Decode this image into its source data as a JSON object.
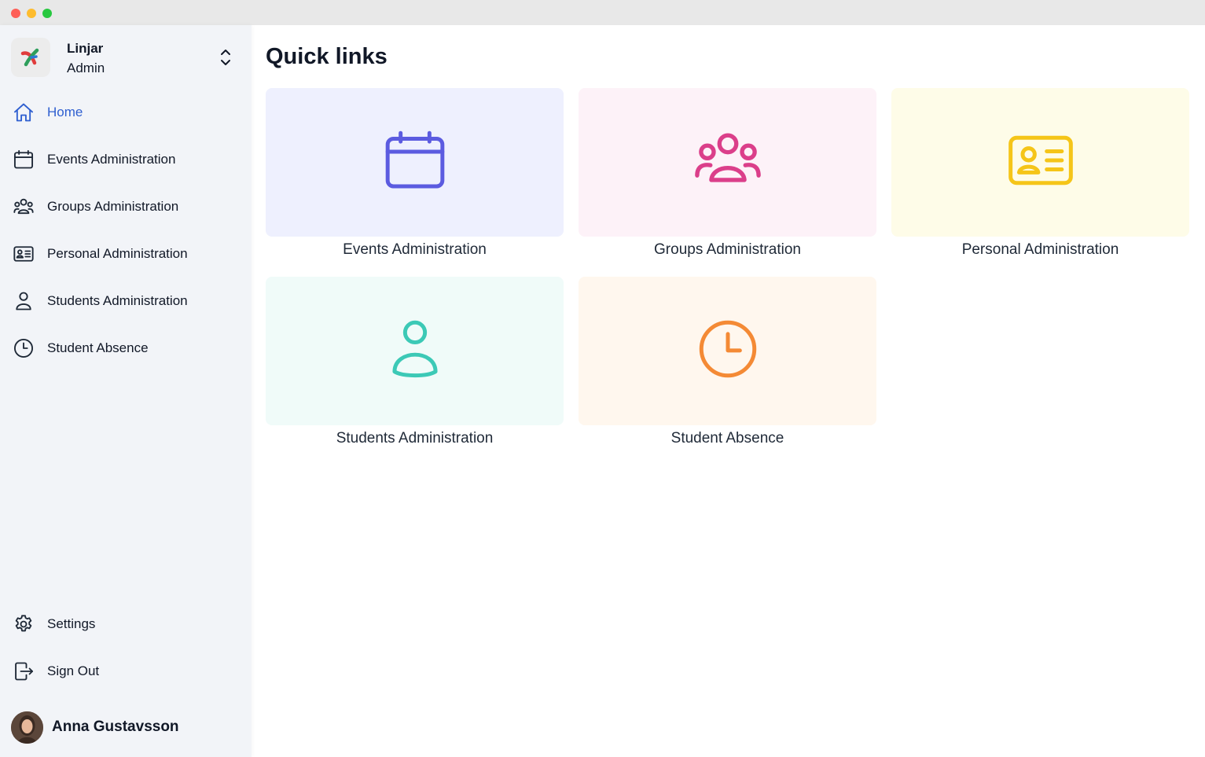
{
  "window": {
    "controls": [
      "close",
      "minimize",
      "maximize"
    ]
  },
  "org": {
    "name": "Linjar",
    "role": "Admin",
    "logo_icon": "linjar-logo-icon",
    "switch_icon": "chevron-up-down-icon"
  },
  "nav": {
    "items": [
      {
        "label": "Home",
        "icon": "home-icon",
        "active": true
      },
      {
        "label": "Events Administration",
        "icon": "calendar-icon"
      },
      {
        "label": "Groups Administration",
        "icon": "user-group-icon"
      },
      {
        "label": "Personal Administration",
        "icon": "id-card-icon"
      },
      {
        "label": "Students Administration",
        "icon": "user-icon"
      },
      {
        "label": "Student Absence",
        "icon": "clock-icon"
      }
    ],
    "bottom": [
      {
        "label": "Settings",
        "icon": "gear-icon"
      },
      {
        "label": "Sign Out",
        "icon": "sign-out-icon"
      }
    ]
  },
  "user": {
    "name": "Anna Gustavsson"
  },
  "main": {
    "title": "Quick links",
    "cards": [
      {
        "label": "Events Administration",
        "icon": "calendar-icon",
        "bg": "#eef0fe",
        "color": "#5b5be0"
      },
      {
        "label": "Groups Administration",
        "icon": "user-group-icon",
        "bg": "#fdf2f8",
        "color": "#db3f8a"
      },
      {
        "label": "Personal Administration",
        "icon": "id-card-icon",
        "bg": "#fefce8",
        "color": "#f5c518"
      },
      {
        "label": "Students Administration",
        "icon": "user-icon",
        "bg": "#f0fbf9",
        "color": "#3cc9b6"
      },
      {
        "label": "Student Absence",
        "icon": "clock-icon",
        "bg": "#fff7ee",
        "color": "#f48a35"
      }
    ]
  },
  "colors": {
    "accent": "#2f5fd0",
    "sidebar_bg": "#f2f4f8"
  }
}
